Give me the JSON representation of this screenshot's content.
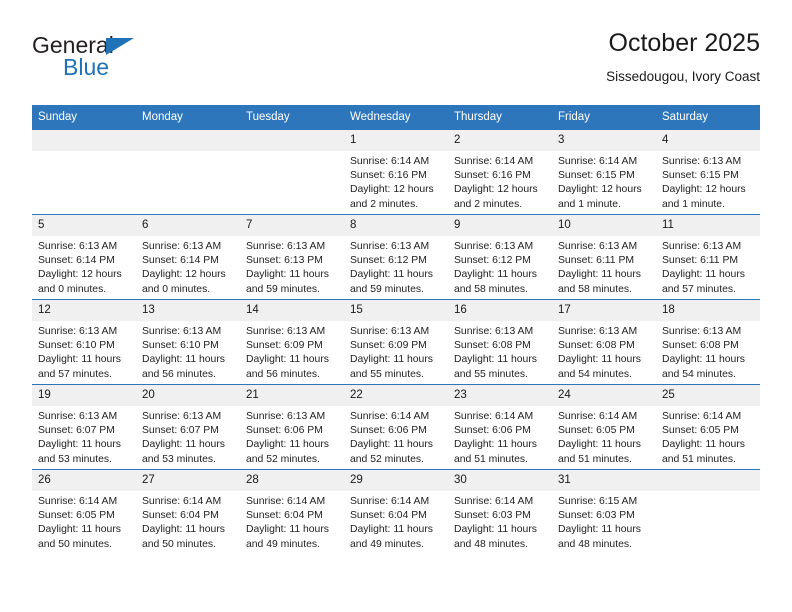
{
  "brand": {
    "line1": "General",
    "line2": "Blue",
    "triangle_icon": "brand-triangle-icon",
    "accent_color": "#1f72b8"
  },
  "header": {
    "title": "October 2025",
    "subtitle": "Sissedougou, Ivory Coast"
  },
  "theme": {
    "header_row_color": "#2e76bc",
    "daynum_band_color": "#f0f0f0",
    "text_color": "#1a1a1a"
  },
  "weekday_headers": [
    "Sunday",
    "Monday",
    "Tuesday",
    "Wednesday",
    "Thursday",
    "Friday",
    "Saturday"
  ],
  "weeks": [
    [
      {
        "day": "",
        "sunrise": "",
        "sunset": "",
        "daylight": ""
      },
      {
        "day": "",
        "sunrise": "",
        "sunset": "",
        "daylight": ""
      },
      {
        "day": "",
        "sunrise": "",
        "sunset": "",
        "daylight": ""
      },
      {
        "day": "1",
        "sunrise": "Sunrise: 6:14 AM",
        "sunset": "Sunset: 6:16 PM",
        "daylight": "Daylight: 12 hours and 2 minutes."
      },
      {
        "day": "2",
        "sunrise": "Sunrise: 6:14 AM",
        "sunset": "Sunset: 6:16 PM",
        "daylight": "Daylight: 12 hours and 2 minutes."
      },
      {
        "day": "3",
        "sunrise": "Sunrise: 6:14 AM",
        "sunset": "Sunset: 6:15 PM",
        "daylight": "Daylight: 12 hours and 1 minute."
      },
      {
        "day": "4",
        "sunrise": "Sunrise: 6:13 AM",
        "sunset": "Sunset: 6:15 PM",
        "daylight": "Daylight: 12 hours and 1 minute."
      }
    ],
    [
      {
        "day": "5",
        "sunrise": "Sunrise: 6:13 AM",
        "sunset": "Sunset: 6:14 PM",
        "daylight": "Daylight: 12 hours and 0 minutes."
      },
      {
        "day": "6",
        "sunrise": "Sunrise: 6:13 AM",
        "sunset": "Sunset: 6:14 PM",
        "daylight": "Daylight: 12 hours and 0 minutes."
      },
      {
        "day": "7",
        "sunrise": "Sunrise: 6:13 AM",
        "sunset": "Sunset: 6:13 PM",
        "daylight": "Daylight: 11 hours and 59 minutes."
      },
      {
        "day": "8",
        "sunrise": "Sunrise: 6:13 AM",
        "sunset": "Sunset: 6:12 PM",
        "daylight": "Daylight: 11 hours and 59 minutes."
      },
      {
        "day": "9",
        "sunrise": "Sunrise: 6:13 AM",
        "sunset": "Sunset: 6:12 PM",
        "daylight": "Daylight: 11 hours and 58 minutes."
      },
      {
        "day": "10",
        "sunrise": "Sunrise: 6:13 AM",
        "sunset": "Sunset: 6:11 PM",
        "daylight": "Daylight: 11 hours and 58 minutes."
      },
      {
        "day": "11",
        "sunrise": "Sunrise: 6:13 AM",
        "sunset": "Sunset: 6:11 PM",
        "daylight": "Daylight: 11 hours and 57 minutes."
      }
    ],
    [
      {
        "day": "12",
        "sunrise": "Sunrise: 6:13 AM",
        "sunset": "Sunset: 6:10 PM",
        "daylight": "Daylight: 11 hours and 57 minutes."
      },
      {
        "day": "13",
        "sunrise": "Sunrise: 6:13 AM",
        "sunset": "Sunset: 6:10 PM",
        "daylight": "Daylight: 11 hours and 56 minutes."
      },
      {
        "day": "14",
        "sunrise": "Sunrise: 6:13 AM",
        "sunset": "Sunset: 6:09 PM",
        "daylight": "Daylight: 11 hours and 56 minutes."
      },
      {
        "day": "15",
        "sunrise": "Sunrise: 6:13 AM",
        "sunset": "Sunset: 6:09 PM",
        "daylight": "Daylight: 11 hours and 55 minutes."
      },
      {
        "day": "16",
        "sunrise": "Sunrise: 6:13 AM",
        "sunset": "Sunset: 6:08 PM",
        "daylight": "Daylight: 11 hours and 55 minutes."
      },
      {
        "day": "17",
        "sunrise": "Sunrise: 6:13 AM",
        "sunset": "Sunset: 6:08 PM",
        "daylight": "Daylight: 11 hours and 54 minutes."
      },
      {
        "day": "18",
        "sunrise": "Sunrise: 6:13 AM",
        "sunset": "Sunset: 6:08 PM",
        "daylight": "Daylight: 11 hours and 54 minutes."
      }
    ],
    [
      {
        "day": "19",
        "sunrise": "Sunrise: 6:13 AM",
        "sunset": "Sunset: 6:07 PM",
        "daylight": "Daylight: 11 hours and 53 minutes."
      },
      {
        "day": "20",
        "sunrise": "Sunrise: 6:13 AM",
        "sunset": "Sunset: 6:07 PM",
        "daylight": "Daylight: 11 hours and 53 minutes."
      },
      {
        "day": "21",
        "sunrise": "Sunrise: 6:13 AM",
        "sunset": "Sunset: 6:06 PM",
        "daylight": "Daylight: 11 hours and 52 minutes."
      },
      {
        "day": "22",
        "sunrise": "Sunrise: 6:14 AM",
        "sunset": "Sunset: 6:06 PM",
        "daylight": "Daylight: 11 hours and 52 minutes."
      },
      {
        "day": "23",
        "sunrise": "Sunrise: 6:14 AM",
        "sunset": "Sunset: 6:06 PM",
        "daylight": "Daylight: 11 hours and 51 minutes."
      },
      {
        "day": "24",
        "sunrise": "Sunrise: 6:14 AM",
        "sunset": "Sunset: 6:05 PM",
        "daylight": "Daylight: 11 hours and 51 minutes."
      },
      {
        "day": "25",
        "sunrise": "Sunrise: 6:14 AM",
        "sunset": "Sunset: 6:05 PM",
        "daylight": "Daylight: 11 hours and 51 minutes."
      }
    ],
    [
      {
        "day": "26",
        "sunrise": "Sunrise: 6:14 AM",
        "sunset": "Sunset: 6:05 PM",
        "daylight": "Daylight: 11 hours and 50 minutes."
      },
      {
        "day": "27",
        "sunrise": "Sunrise: 6:14 AM",
        "sunset": "Sunset: 6:04 PM",
        "daylight": "Daylight: 11 hours and 50 minutes."
      },
      {
        "day": "28",
        "sunrise": "Sunrise: 6:14 AM",
        "sunset": "Sunset: 6:04 PM",
        "daylight": "Daylight: 11 hours and 49 minutes."
      },
      {
        "day": "29",
        "sunrise": "Sunrise: 6:14 AM",
        "sunset": "Sunset: 6:04 PM",
        "daylight": "Daylight: 11 hours and 49 minutes."
      },
      {
        "day": "30",
        "sunrise": "Sunrise: 6:14 AM",
        "sunset": "Sunset: 6:03 PM",
        "daylight": "Daylight: 11 hours and 48 minutes."
      },
      {
        "day": "31",
        "sunrise": "Sunrise: 6:15 AM",
        "sunset": "Sunset: 6:03 PM",
        "daylight": "Daylight: 11 hours and 48 minutes."
      },
      {
        "day": "",
        "sunrise": "",
        "sunset": "",
        "daylight": ""
      }
    ]
  ]
}
